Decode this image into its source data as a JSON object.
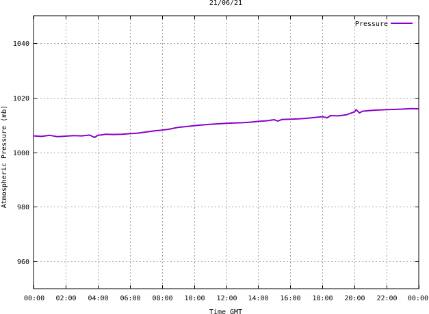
{
  "chart_data": {
    "type": "line",
    "title": "21/06/21",
    "xlabel": "Time GMT",
    "ylabel": "Atmospheric Pressure (mb)",
    "xlim": [
      0,
      24
    ],
    "ylim": [
      950,
      1050
    ],
    "x_ticks": [
      "00:00",
      "02:00",
      "04:00",
      "06:00",
      "08:00",
      "10:00",
      "12:00",
      "14:00",
      "16:00",
      "18:00",
      "20:00",
      "22:00",
      "00:00"
    ],
    "y_ticks": [
      960,
      980,
      1000,
      1020,
      1040
    ],
    "grid": true,
    "legend_position": "top-right",
    "series": [
      {
        "name": "Pressure",
        "color": "#8b00c8",
        "x": [
          0,
          0.5,
          1,
          1.5,
          2,
          2.5,
          3,
          3.5,
          3.8,
          4,
          4.3,
          4.5,
          5,
          5.5,
          6,
          6.5,
          7,
          7.5,
          8,
          8.5,
          9,
          9.5,
          10,
          10.5,
          11,
          11.5,
          12,
          12.5,
          13,
          13.5,
          14,
          14.5,
          15,
          15.2,
          15.5,
          16,
          16.5,
          17,
          17.5,
          18,
          18.3,
          18.5,
          19,
          19.5,
          20,
          20.1,
          20.3,
          20.5,
          21,
          21.5,
          22,
          22.5,
          23,
          23.5,
          24
        ],
        "values": [
          1006.0,
          1005.8,
          1006.2,
          1005.7,
          1005.9,
          1006.1,
          1006.0,
          1006.3,
          1005.4,
          1006.2,
          1006.4,
          1006.6,
          1006.5,
          1006.6,
          1006.8,
          1007.0,
          1007.4,
          1007.8,
          1008.1,
          1008.5,
          1009.1,
          1009.4,
          1009.7,
          1010.0,
          1010.2,
          1010.4,
          1010.6,
          1010.7,
          1010.8,
          1011.0,
          1011.3,
          1011.5,
          1011.9,
          1011.4,
          1012.0,
          1012.1,
          1012.2,
          1012.4,
          1012.7,
          1013.0,
          1012.6,
          1013.4,
          1013.3,
          1013.7,
          1014.8,
          1015.6,
          1014.4,
          1015.0,
          1015.3,
          1015.5,
          1015.6,
          1015.7,
          1015.8,
          1016.0,
          1015.9
        ]
      }
    ]
  }
}
